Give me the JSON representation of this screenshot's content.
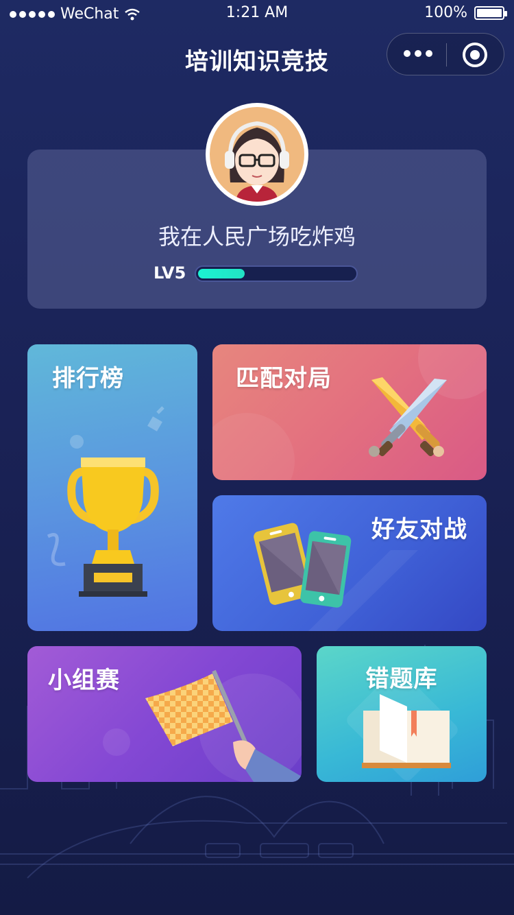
{
  "status_bar": {
    "carrier": "WeChat",
    "time": "1:21 AM",
    "battery": "100%"
  },
  "nav": {
    "title": "培训知识竞技"
  },
  "profile": {
    "name": "我在人民广场吃炸鸡",
    "level": "LV5",
    "level_progress": 0.3
  },
  "tiles": {
    "rank": "排行榜",
    "match": "匹配对局",
    "friend": "好友对战",
    "group": "小组赛",
    "wrong": "错题库"
  },
  "colors": {
    "progress": "#1cf3d2",
    "background": "#1e2a63"
  }
}
